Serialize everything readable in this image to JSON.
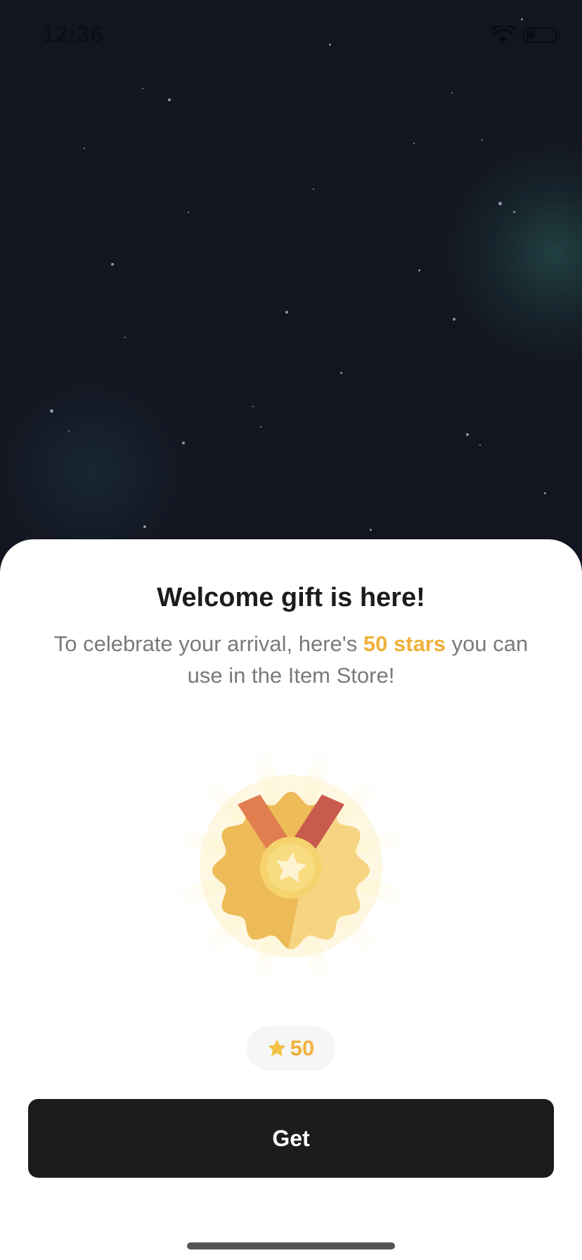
{
  "status_bar": {
    "time": "12:36",
    "wifi_icon": "wifi-icon",
    "battery_icon": "battery-icon"
  },
  "gift_sheet": {
    "title": "Welcome gift is here!",
    "description_before": "To celebrate your arrival, here's ",
    "description_highlight": "50 stars",
    "description_after": " you can use in the Item Store!",
    "medal_icon": "medal-icon",
    "reward": {
      "icon": "star-icon",
      "value": "50"
    },
    "get_button_label": "Get"
  },
  "colors": {
    "backdrop": "#131621",
    "accent": "#f0b03a",
    "button": "#1c1c1e",
    "sheet": "#ffffff"
  }
}
